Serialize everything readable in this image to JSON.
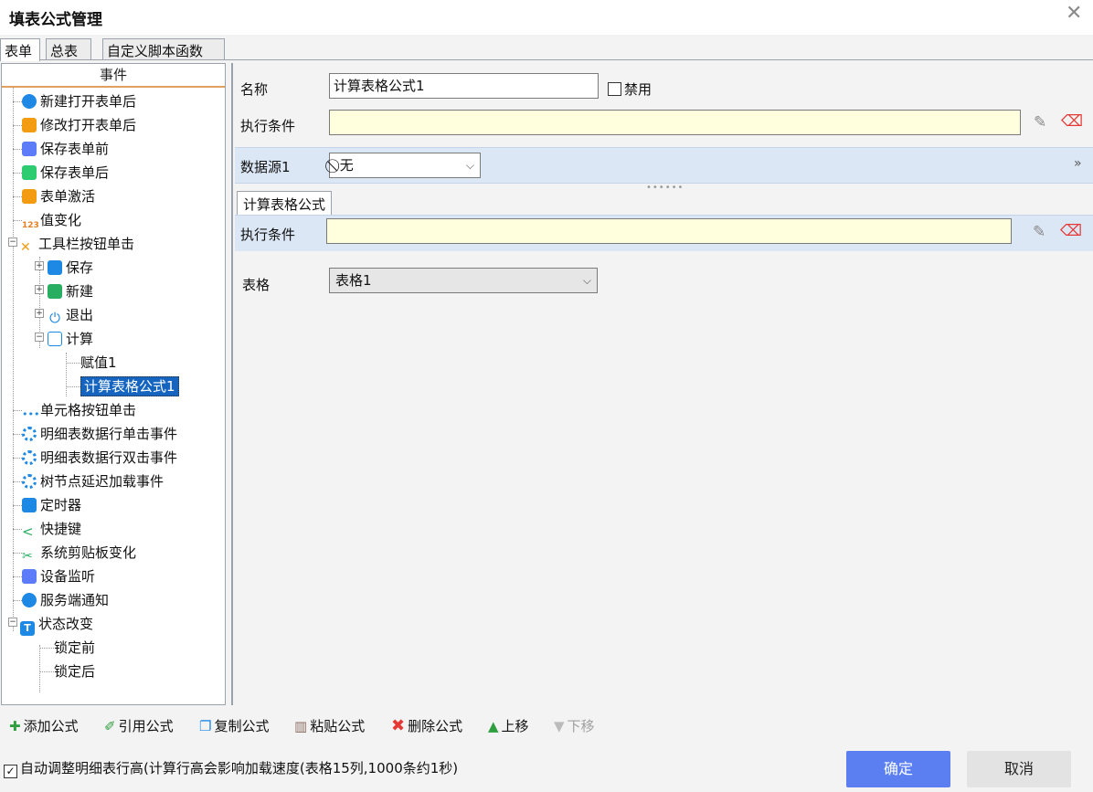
{
  "window": {
    "title": "填表公式管理",
    "close_icon": "close-icon"
  },
  "tabs": [
    {
      "label": "表单"
    },
    {
      "label": "总表"
    },
    {
      "label": "自定义脚本函数"
    }
  ],
  "left_panel": {
    "header": "事件",
    "items": [
      {
        "label": "新建打开表单后",
        "icon": "new-open-icon"
      },
      {
        "label": "修改打开表单后",
        "icon": "folder-open-icon"
      },
      {
        "label": "保存表单前",
        "icon": "save-before-icon"
      },
      {
        "label": "保存表单后",
        "icon": "save-after-icon"
      },
      {
        "label": "表单激活",
        "icon": "folder-active-icon"
      },
      {
        "label": "值变化",
        "icon": "value-change-icon"
      },
      {
        "label": "工具栏按钮单击",
        "icon": "tools-icon"
      },
      {
        "label": "保存",
        "icon": "save-icon"
      },
      {
        "label": "新建",
        "icon": "new-icon"
      },
      {
        "label": "退出",
        "icon": "power-icon"
      },
      {
        "label": "计算",
        "icon": "calc-icon"
      },
      {
        "label": "赋值1",
        "icon": ""
      },
      {
        "label": "计算表格公式1",
        "icon": ""
      },
      {
        "label": "单元格按钮单击",
        "icon": "dots-icon"
      },
      {
        "label": "明细表数据行单击事件",
        "icon": "loading-icon"
      },
      {
        "label": "明细表数据行双击事件",
        "icon": "loading-icon"
      },
      {
        "label": "树节点延迟加载事件",
        "icon": "loading-icon"
      },
      {
        "label": "定时器",
        "icon": "timer-icon"
      },
      {
        "label": "快捷键",
        "icon": "share-icon"
      },
      {
        "label": "系统剪贴板变化",
        "icon": "scissors-icon"
      },
      {
        "label": "设备监听",
        "icon": "device-icon"
      },
      {
        "label": "服务端通知",
        "icon": "notify-icon"
      },
      {
        "label": "状态改变",
        "icon": "t-icon"
      },
      {
        "label": "锁定前",
        "icon": ""
      },
      {
        "label": "锁定后",
        "icon": ""
      }
    ]
  },
  "form": {
    "name_label": "名称",
    "name_value": "计算表格公式1",
    "disable_label": "禁用",
    "condition_label": "执行条件",
    "condition_value": "",
    "datasource_label": "数据源1",
    "datasource_value": "⃠ 无",
    "section_tab": "计算表格公式",
    "section_condition_label": "执行条件",
    "section_condition_value": "",
    "table_label": "表格",
    "table_value": "表格1"
  },
  "toolbar": {
    "add": "添加公式",
    "reference": "引用公式",
    "copy": "复制公式",
    "paste": "粘贴公式",
    "delete": "删除公式",
    "up": "上移",
    "down": "下移"
  },
  "footer": {
    "auto_adjust": "自动调整明细表行高(计算行高会影响加载速度(表格15列,1000条约1秒)",
    "ok": "确定",
    "cancel": "取消"
  },
  "colors": {
    "accent": "#5b7ff0",
    "selection": "#1565c0",
    "band": "#dce7f5",
    "yellow_input": "#ffffdd"
  }
}
